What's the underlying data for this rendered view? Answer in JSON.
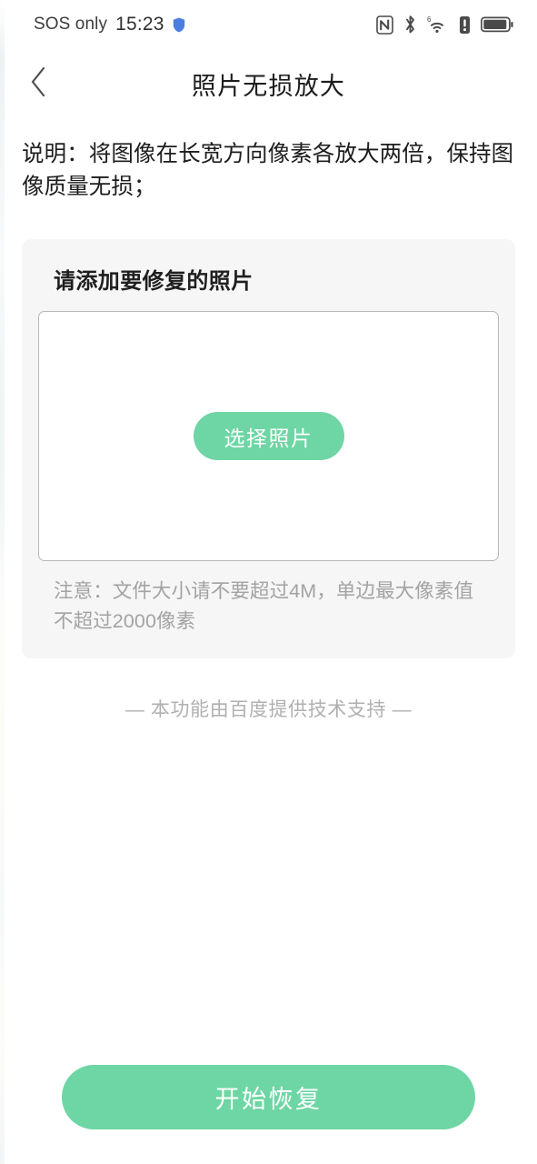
{
  "status_bar": {
    "carrier": "SOS only",
    "time": "15:23",
    "shield_icon": "shield-icon",
    "icons": [
      {
        "name": "nfc-icon",
        "label": "NFC"
      },
      {
        "name": "bluetooth-icon",
        "label": "Bluetooth"
      },
      {
        "name": "wifi-icon",
        "label": "WiFi 6",
        "badge": "6"
      },
      {
        "name": "alert-icon",
        "label": "Alert"
      },
      {
        "name": "battery-icon",
        "label": "Battery"
      }
    ]
  },
  "nav": {
    "back_icon": "chevron-left-icon",
    "title": "照片无损放大"
  },
  "description": "说明：将图像在长宽方向像素各放大两倍，保持图像质量无损；",
  "upload_card": {
    "title": "请添加要修复的照片",
    "select_button_label": "选择照片",
    "note": "注意：文件大小请不要超过4M，单边最大像素值不超过2000像素"
  },
  "credit": "— 本功能由百度提供技术支持 —",
  "bottom": {
    "start_button_label": "开始恢复"
  },
  "colors": {
    "accent_green": "#6ed6a4",
    "card_background": "#f6f6f6",
    "text_primary": "#1d1d1d",
    "text_muted": "#a3a3a3",
    "shield_blue": "#4a7fe0"
  }
}
